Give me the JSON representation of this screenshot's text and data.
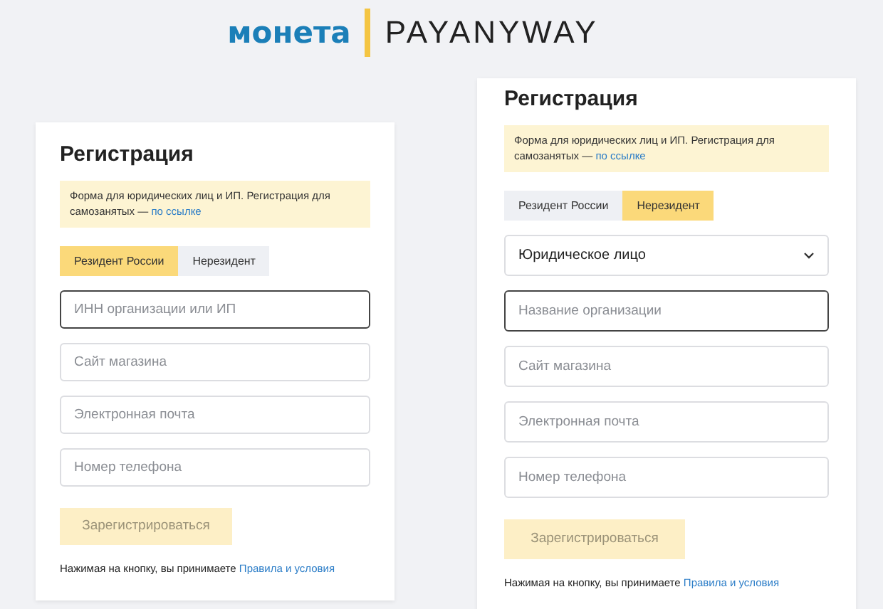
{
  "logo": {
    "left": "монета",
    "right": "PAYANYWAY"
  },
  "cards": [
    {
      "title": "Регистрация",
      "notice": {
        "text": "Форма для юридических лиц и ИП. Регистрация для самозанятых — ",
        "link": "по ссылке"
      },
      "tabs": [
        {
          "label": "Резидент России",
          "selected": true
        },
        {
          "label": "Нерезидент",
          "selected": false
        }
      ],
      "fields": [
        {
          "kind": "input",
          "placeholder": "ИНН организации или ИП",
          "focused": true
        },
        {
          "kind": "input",
          "placeholder": "Сайт магазина",
          "focused": false
        },
        {
          "kind": "input",
          "placeholder": "Электронная почта",
          "focused": false
        },
        {
          "kind": "input",
          "placeholder": "Номер телефона",
          "focused": false
        }
      ],
      "button": {
        "label": "Зарегистрироваться",
        "disabled": true
      },
      "terms": {
        "text": "Нажимая на кнопку, вы принимаете ",
        "link": "Правила и условия"
      }
    },
    {
      "title": "Регистрация",
      "notice": {
        "text": "Форма для юридических лиц и ИП. Регистрация для самозанятых — ",
        "link": "по ссылке"
      },
      "tabs": [
        {
          "label": "Резидент России",
          "selected": false
        },
        {
          "label": "Нерезидент",
          "selected": true
        }
      ],
      "fields": [
        {
          "kind": "select",
          "value": "Юридическое лицо",
          "focused": false
        },
        {
          "kind": "input",
          "placeholder": "Название организации",
          "focused": true
        },
        {
          "kind": "input",
          "placeholder": "Сайт магазина",
          "focused": false
        },
        {
          "kind": "input",
          "placeholder": "Электронная почта",
          "focused": false
        },
        {
          "kind": "input",
          "placeholder": "Номер телефона",
          "focused": false
        }
      ],
      "button": {
        "label": "Зарегистрироваться",
        "disabled": true
      },
      "terms": {
        "text": "Нажимая на кнопку, вы принимаете ",
        "link": "Правила и условия"
      }
    }
  ]
}
